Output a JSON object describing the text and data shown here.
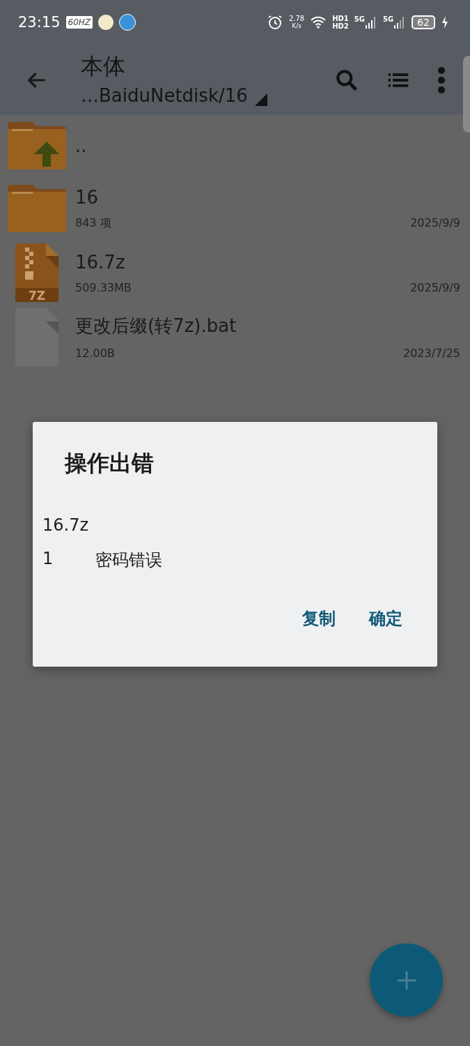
{
  "status_bar": {
    "time": "23:15",
    "refresh_badge": "60HZ",
    "speed_value": "2.78",
    "speed_unit": "K/s",
    "hd_top": "HD1",
    "hd_bottom": "HD2",
    "sim1": "5G",
    "sim2": "5G",
    "battery": "62"
  },
  "toolbar": {
    "title": "本体",
    "path": "…BaiduNetdisk/16"
  },
  "files": [
    {
      "kind": "up",
      "name": ".."
    },
    {
      "kind": "folder",
      "name": "16",
      "detail": "843 项",
      "date": "2025/9/9"
    },
    {
      "kind": "archive",
      "name": "16.7z",
      "detail": "509.33MB",
      "date": "2025/9/9",
      "badge": "7Z"
    },
    {
      "kind": "file",
      "name": "更改后缀(转7z).bat",
      "detail": "12.00B",
      "date": "2023/7/25"
    }
  ],
  "dialog": {
    "title": "操作出错",
    "filename": "16.7z",
    "error_code": "1",
    "error_message": "密码错误",
    "buttons": [
      "复制",
      "确定"
    ]
  }
}
